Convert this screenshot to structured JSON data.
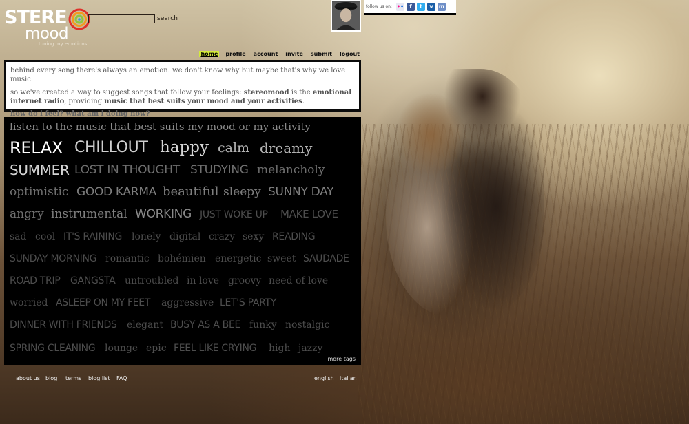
{
  "header": {
    "logo_word1": "STERE",
    "logo_word2": "mood",
    "logo_tagline": "tuning my emotions",
    "search_label": "search",
    "search_value": ""
  },
  "social": {
    "label": "follow us on:",
    "icons": [
      "flickr",
      "facebook",
      "twitter",
      "vimeo",
      "myspace"
    ]
  },
  "nav": {
    "items": [
      "home",
      "profile",
      "account",
      "invite",
      "submit",
      "logout"
    ],
    "active": "home"
  },
  "intro": {
    "line1": "behind every song there's always an emotion. we don't know why but maybe that's why we love music.",
    "line2_a": "so we've created a way to suggest songs that follow your feelings: ",
    "line2_b": "stereomood",
    "line2_c": " is the ",
    "line2_d": "emotional internet radio",
    "line2_e": ", providing ",
    "line2_f": "music that best suits your mood and your activities",
    "line2_g": ".",
    "question": "how do i feel? what am i doing now?"
  },
  "cloud": {
    "heading": "listen to the music that best suits my mood or my activity",
    "more_tags": "more tags",
    "tags": [
      "RELAX",
      "CHILLOUT",
      "happy",
      "calm",
      "dreamy",
      "SUMMER",
      "LOST IN THOUGHT",
      "STUDYING",
      "melancholy",
      "optimistic",
      "GOOD KARMA",
      "beautiful",
      "sleepy",
      "SUNNY DAY",
      "angry",
      "instrumental",
      "WORKING",
      "JUST WOKE UP",
      "MAKE LOVE",
      "sad",
      "cool",
      "IT'S RAINING",
      "lonely",
      "digital",
      "crazy",
      "sexy",
      "READING",
      "SUNDAY MORNING",
      "romantic",
      "bohémien",
      "energetic",
      "sweet",
      "SAUDADE",
      "ROAD TRIP",
      "GANGSTA",
      "untroubled",
      "in love",
      "groovy",
      "need of love",
      "worried",
      "ASLEEP ON MY FEET",
      "aggressive",
      "LET'S PARTY",
      "DINNER WITH FRIENDS",
      "elegant",
      "BUSY AS A BEE",
      "funky",
      "nostalgic",
      "SPRING CLEANING",
      "lounge",
      "epic",
      "FEEL LIKE CRYING",
      "high",
      "jazzy"
    ]
  },
  "footer": {
    "links": [
      "about us",
      "blog",
      "terms",
      "blog list",
      "FAQ"
    ],
    "languages": [
      "english",
      "italian"
    ]
  },
  "colors": {
    "nav_active": "#d4ea3c",
    "panel_black": "#000000",
    "tag_gray": "#8a8a8a"
  }
}
